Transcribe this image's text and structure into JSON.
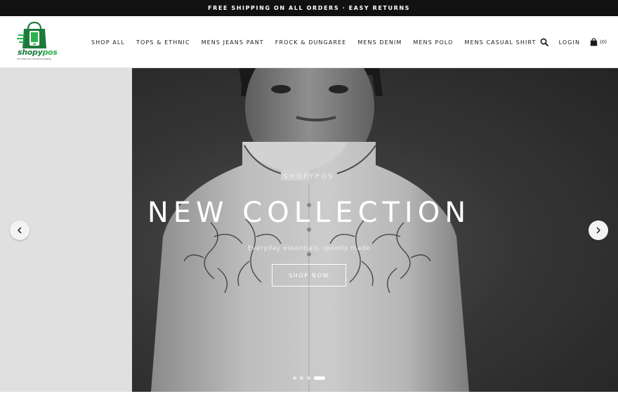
{
  "announcement": {
    "text": "FREE SHIPPING ON ALL ORDERS · EASY RETURNS"
  },
  "logo": {
    "brand_main": "shopy",
    "brand_accent": "pos",
    "tagline": "THE SMART WAY FOR RETAIL BUSINESS"
  },
  "nav": {
    "items": [
      {
        "label": "SHOP ALL"
      },
      {
        "label": "TOPS & ETHNIC"
      },
      {
        "label": "MENS JEANS PANT"
      },
      {
        "label": "FROCK & DUNGAREE"
      },
      {
        "label": "MENS DENIM"
      },
      {
        "label": "MENS POLO"
      },
      {
        "label": "MENS CASUAL SHIRT"
      }
    ]
  },
  "tools": {
    "search_icon": "search-icon",
    "login_label": "LOGIN",
    "cart_icon": "shopping-bag-icon",
    "cart_count": "(0)"
  },
  "hero": {
    "subheading": "SHOPYPOS",
    "heading": "NEW COLLECTION",
    "text": "Everyday essentials, quietly made",
    "button_label": "SHOP NOW",
    "prev_icon": "chevron-left-icon",
    "next_icon": "chevron-right-icon",
    "slide_count": 4,
    "active_slide": 4
  },
  "colors": {
    "announcement_bg": "#111111",
    "brand_green": "#1e7a3c",
    "accent_green": "#2bb24c",
    "text": "#1c1c1c"
  }
}
